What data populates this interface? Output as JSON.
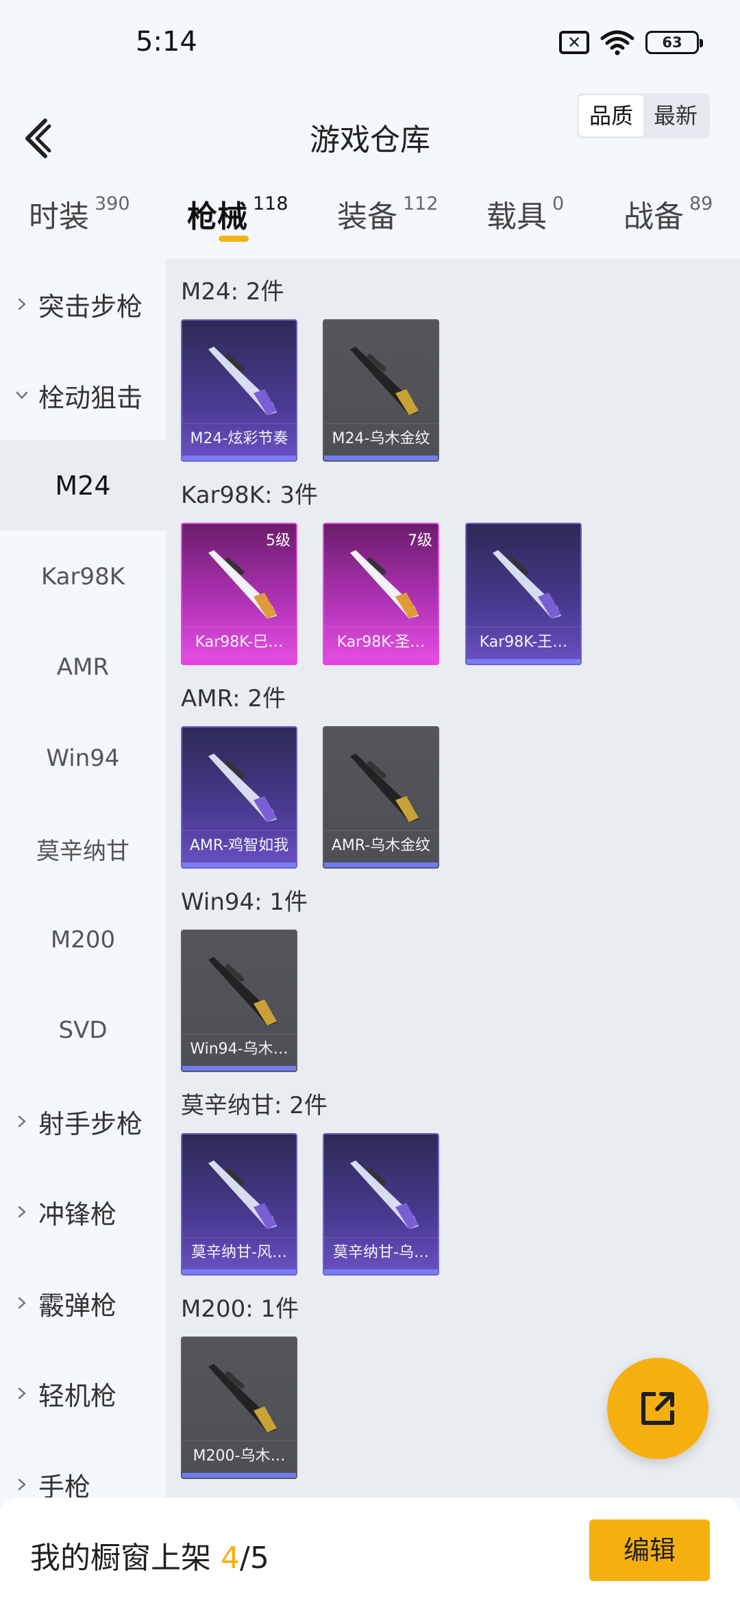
{
  "status": {
    "time": "5:14",
    "battery": "63"
  },
  "header": {
    "title": "游戏仓库",
    "sort_options": [
      "品质",
      "最新"
    ],
    "active_sort": "品质"
  },
  "tabs": [
    {
      "label": "时装",
      "count": "390"
    },
    {
      "label": "枪械",
      "count": "118",
      "active": true
    },
    {
      "label": "装备",
      "count": "112"
    },
    {
      "label": "载具",
      "count": "0"
    },
    {
      "label": "战备",
      "count": "89"
    }
  ],
  "sidebar": {
    "items": [
      {
        "label": "突击步枪",
        "type": "category",
        "expanded": false
      },
      {
        "label": "栓动狙击",
        "type": "category",
        "expanded": true
      },
      {
        "label": "M24",
        "type": "sub",
        "active": true
      },
      {
        "label": "Kar98K",
        "type": "sub"
      },
      {
        "label": "AMR",
        "type": "sub"
      },
      {
        "label": "Win94",
        "type": "sub"
      },
      {
        "label": "莫辛纳甘",
        "type": "sub"
      },
      {
        "label": "M200",
        "type": "sub"
      },
      {
        "label": "SVD",
        "type": "sub"
      },
      {
        "label": "射手步枪",
        "type": "category",
        "expanded": false
      },
      {
        "label": "冲锋枪",
        "type": "category",
        "expanded": false
      },
      {
        "label": "霰弹枪",
        "type": "category",
        "expanded": false
      },
      {
        "label": "轻机枪",
        "type": "category",
        "expanded": false
      },
      {
        "label": "手枪",
        "type": "category",
        "expanded": false
      }
    ]
  },
  "groups": [
    {
      "title": "M24: 2件",
      "items": [
        {
          "name": "M24-炫彩节奏",
          "rarity": "purple"
        },
        {
          "name": "M24-乌木金纹",
          "rarity": "gray"
        }
      ]
    },
    {
      "title": "Kar98K: 3件",
      "items": [
        {
          "name": "Kar98K-巳…",
          "rarity": "pink",
          "level": "5级"
        },
        {
          "name": "Kar98K-圣…",
          "rarity": "pink",
          "level": "7级"
        },
        {
          "name": "Kar98K-王…",
          "rarity": "purple"
        }
      ]
    },
    {
      "title": "AMR: 2件",
      "items": [
        {
          "name": "AMR-鸡智如我",
          "rarity": "purple"
        },
        {
          "name": "AMR-乌木金纹",
          "rarity": "gray"
        }
      ]
    },
    {
      "title": "Win94: 1件",
      "items": [
        {
          "name": "Win94-乌木…",
          "rarity": "gray"
        }
      ]
    },
    {
      "title": "莫辛纳甘: 2件",
      "items": [
        {
          "name": "莫辛纳甘-风…",
          "rarity": "purple"
        },
        {
          "name": "莫辛纳甘-乌…",
          "rarity": "purple"
        }
      ]
    },
    {
      "title": "M200: 1件",
      "items": [
        {
          "name": "M200-乌木…",
          "rarity": "gray"
        }
      ]
    }
  ],
  "bottom": {
    "shelf_label": "我的橱窗上架",
    "shelf_current": "4",
    "shelf_total": "/5",
    "edit_label": "编辑"
  },
  "colors": {
    "accent": "#f5b010",
    "rarity_purple": "#6c62c9",
    "rarity_pink": "#e24be0",
    "rarity_gray": "#55555b"
  }
}
